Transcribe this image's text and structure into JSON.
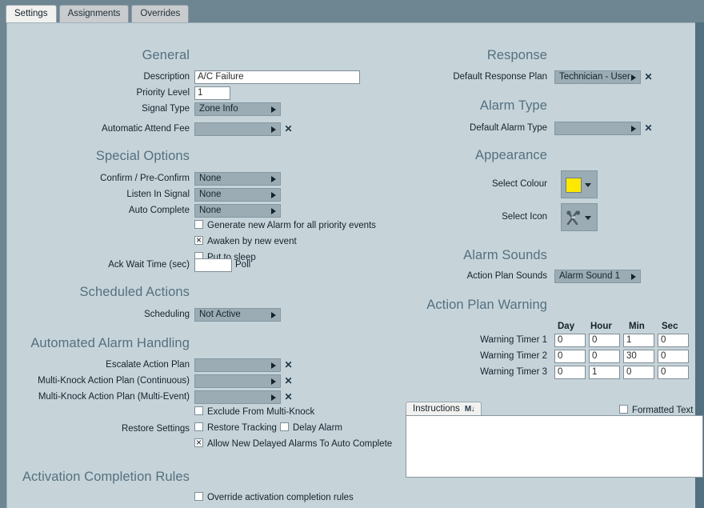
{
  "tabs": [
    {
      "label": "Settings",
      "active": true
    },
    {
      "label": "Assignments",
      "active": false
    },
    {
      "label": "Overrides",
      "active": false
    }
  ],
  "sections": {
    "general": "General",
    "special_options": "Special Options",
    "scheduled_actions": "Scheduled Actions",
    "automated_alarm_handling": "Automated Alarm Handling",
    "activation_completion_rules": "Activation Completion Rules",
    "response": "Response",
    "alarm_type": "Alarm Type",
    "appearance": "Appearance",
    "alarm_sounds": "Alarm Sounds",
    "action_plan_warning": "Action Plan Warning"
  },
  "general": {
    "description_label": "Description",
    "description_value": "A/C Failure",
    "priority_label": "Priority Level",
    "priority_value": "1",
    "signal_type_label": "Signal Type",
    "signal_type_value": "Zone Info",
    "attend_fee_label": "Automatic Attend Fee",
    "attend_fee_value": "",
    "clear_icon": "clear-x-icon"
  },
  "special_options": {
    "confirm_label": "Confirm / Pre-Confirm",
    "confirm_value": "None",
    "listen_label": "Listen In Signal",
    "listen_value": "None",
    "autocomplete_label": "Auto Complete",
    "autocomplete_value": "None",
    "generate_new_alarm": "Generate new Alarm for all priority events",
    "generate_new_alarm_checked": false,
    "awaken": "Awaken by new event",
    "awaken_checked": true,
    "put_to_sleep": "Put to sleep",
    "put_to_sleep_checked": false,
    "ack_wait_label": "Ack Wait Time (sec)",
    "ack_wait_value": "",
    "poll_label": "Poll"
  },
  "scheduled_actions": {
    "scheduling_label": "Scheduling",
    "scheduling_value": "Not Active"
  },
  "automated": {
    "escalate_label": "Escalate Action Plan",
    "escalate_value": "",
    "mk_continuous_label": "Multi-Knock Action Plan (Continuous)",
    "mk_continuous_value": "",
    "mk_multievent_label": "Multi-Knock Action Plan (Multi-Event)",
    "mk_multievent_value": "",
    "exclude_label": "Exclude From Multi-Knock",
    "exclude_checked": false,
    "restore_settings_label": "Restore Settings",
    "restore_tracking_label": "Restore Tracking",
    "restore_tracking_checked": false,
    "delay_alarm_label": "Delay Alarm",
    "delay_alarm_checked": false,
    "allow_delayed_label": "Allow New Delayed Alarms To Auto Complete",
    "allow_delayed_checked": true
  },
  "activation": {
    "override_label": "Override activation completion rules",
    "override_checked": false
  },
  "response": {
    "default_plan_label": "Default Response Plan",
    "default_plan_value": "Technician - User"
  },
  "alarm_type": {
    "default_type_label": "Default Alarm Type",
    "default_type_value": ""
  },
  "appearance": {
    "colour_label": "Select Colour",
    "colour_value": "#ffe800",
    "icon_label": "Select Icon",
    "icon_name": "tools-wrench-screwdriver-icon"
  },
  "alarm_sounds": {
    "action_plan_sounds_label": "Action Plan Sounds",
    "action_plan_sounds_value": "Alarm Sound 1"
  },
  "action_plan_warning": {
    "columns": [
      "Day",
      "Hour",
      "Min",
      "Sec"
    ],
    "rows": [
      {
        "label": "Warning Timer 1",
        "day": "0",
        "hour": "0",
        "min": "1",
        "sec": "0"
      },
      {
        "label": "Warning Timer 2",
        "day": "0",
        "hour": "0",
        "min": "30",
        "sec": "0"
      },
      {
        "label": "Warning Timer 3",
        "day": "0",
        "hour": "1",
        "min": "0",
        "sec": "0"
      }
    ]
  },
  "instructions": {
    "tab_label": "Instructions",
    "marker_icon": "markdown-m-down-icon",
    "marker_text": "M↓",
    "body_value": "",
    "formatted_text_label": "Formatted Text",
    "formatted_text_checked": false
  },
  "colors": {
    "outer_bg": "#6e8592",
    "panel_bg": "#c6d4da",
    "combo_bg": "#9bacb4",
    "heading": "#55707f",
    "accent_swatch": "#ffe800"
  }
}
